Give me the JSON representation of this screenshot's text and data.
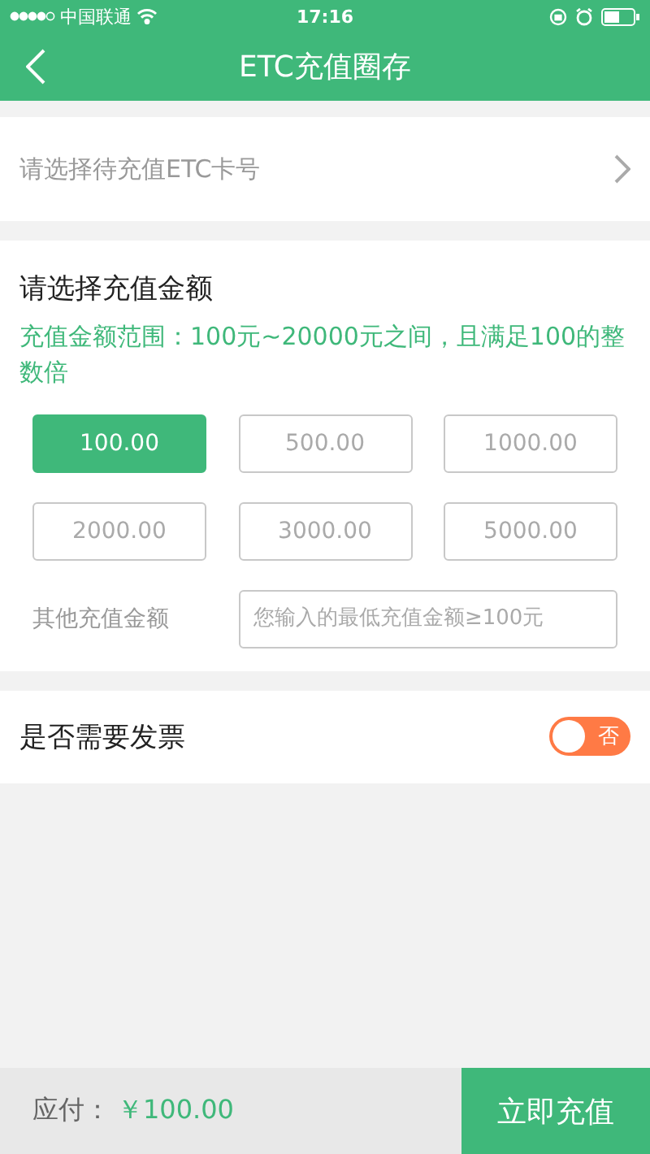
{
  "status_bar": {
    "carrier": "中国联通",
    "time": "17:16"
  },
  "nav": {
    "title": "ETC充值圈存"
  },
  "card_picker": {
    "placeholder": "请选择待充值ETC卡号"
  },
  "amount_section": {
    "title": "请选择充值金额",
    "hint": "充值金额范围：100元~20000元之间，且满足100的整数倍",
    "options": [
      {
        "label": "100.00",
        "selected": true
      },
      {
        "label": "500.00",
        "selected": false
      },
      {
        "label": "1000.00",
        "selected": false
      },
      {
        "label": "2000.00",
        "selected": false
      },
      {
        "label": "3000.00",
        "selected": false
      },
      {
        "label": "5000.00",
        "selected": false
      }
    ],
    "other_label": "其他充值金额",
    "other_placeholder": "您输入的最低充值金额≥100元"
  },
  "invoice": {
    "label": "是否需要发票",
    "on": false,
    "toggle_text": "否"
  },
  "footer": {
    "label": "应付：",
    "amount": "￥100.00",
    "button": "立即充值"
  }
}
